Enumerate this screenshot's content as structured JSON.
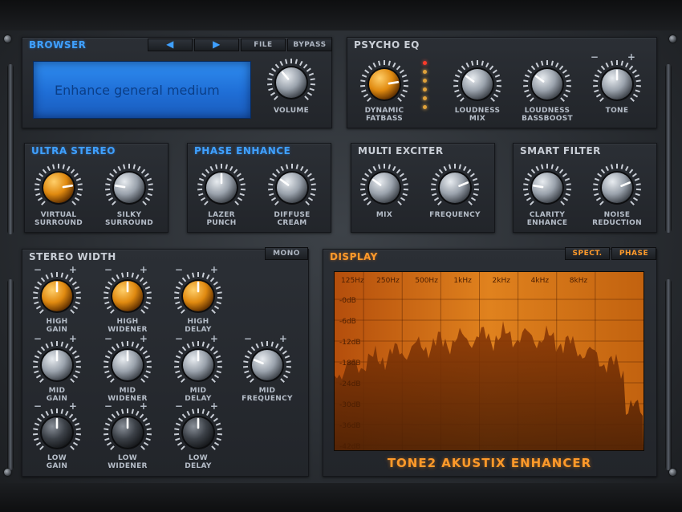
{
  "browser": {
    "title": "BROWSER",
    "prev_icon": "arrow-left-icon",
    "next_icon": "arrow-right-icon",
    "file_label": "FILE",
    "bypass_label": "BYPASS",
    "preset_name": "Enhance general medium",
    "volume_label": "VOLUME",
    "volume_level": 0.35
  },
  "psycho_eq": {
    "title": "PSYCHO EQ",
    "knobs": [
      {
        "label_top": "DYNAMIC",
        "label_bottom": "FATBASS",
        "value": 0.8,
        "color": "orange"
      },
      {
        "label_top": "LOUDNESS",
        "label_bottom": "MIX",
        "value": 0.3,
        "color": "grey"
      },
      {
        "label_top": "LOUDNESS",
        "label_bottom": "BASSBOOST",
        "value": 0.3,
        "color": "grey"
      },
      {
        "label_top": "TONE",
        "label_bottom": "",
        "value": 0.5,
        "color": "grey"
      }
    ],
    "tone_minus": "−",
    "tone_plus": "+"
  },
  "ultra_stereo": {
    "title": "ULTRA STEREO",
    "knobs": [
      {
        "label_top": "VIRTUAL",
        "label_bottom": "SURROUND",
        "value": 0.8,
        "color": "orange"
      },
      {
        "label_top": "SILKY",
        "label_bottom": "SURROUND",
        "value": 0.2,
        "color": "grey"
      }
    ]
  },
  "phase_enhance": {
    "title": "PHASE ENHANCE",
    "knobs": [
      {
        "label_top": "LAZER",
        "label_bottom": "PUNCH",
        "value": 0.5,
        "color": "grey"
      },
      {
        "label_top": "DIFFUSE",
        "label_bottom": "CREAM",
        "value": 0.3,
        "color": "grey"
      }
    ]
  },
  "multi_exciter": {
    "title": "MULTI EXCITER",
    "knobs": [
      {
        "label_top": "MIX",
        "label_bottom": "",
        "value": 0.3,
        "color": "grey"
      },
      {
        "label_top": "FREQUENCY",
        "label_bottom": "",
        "value": 0.75,
        "color": "grey"
      }
    ]
  },
  "smart_filter": {
    "title": "SMART FILTER",
    "knobs": [
      {
        "label_top": "CLARITY",
        "label_bottom": "ENHANCE",
        "value": 0.2,
        "color": "grey"
      },
      {
        "label_top": "NOISE",
        "label_bottom": "REDUCTION",
        "value": 0.75,
        "color": "grey"
      }
    ]
  },
  "stereo_width": {
    "title": "STEREO WIDTH",
    "mono_label": "MONO",
    "minus": "−",
    "plus": "+",
    "knobs": [
      {
        "label_top": "HIGH",
        "label_bottom": "GAIN",
        "value": 0.5,
        "color": "orange"
      },
      {
        "label_top": "HIGH",
        "label_bottom": "WIDENER",
        "value": 0.5,
        "color": "orange"
      },
      {
        "label_top": "HIGH",
        "label_bottom": "DELAY",
        "value": 0.5,
        "color": "orange"
      },
      {
        "label_top": "MID",
        "label_bottom": "GAIN",
        "value": 0.5,
        "color": "grey"
      },
      {
        "label_top": "MID",
        "label_bottom": "WIDENER",
        "value": 0.5,
        "color": "grey"
      },
      {
        "label_top": "MID",
        "label_bottom": "DELAY",
        "value": 0.5,
        "color": "grey"
      },
      {
        "label_top": "LOW",
        "label_bottom": "GAIN",
        "value": 0.5,
        "color": "dark"
      },
      {
        "label_top": "LOW",
        "label_bottom": "WIDENER",
        "value": 0.5,
        "color": "dark"
      },
      {
        "label_top": "LOW",
        "label_bottom": "DELAY",
        "value": 0.5,
        "color": "dark"
      },
      {
        "label_top": "MID",
        "label_bottom": "FREQUENCY",
        "value": 0.25,
        "color": "grey"
      }
    ]
  },
  "display": {
    "title": "DISPLAY",
    "spect_label": "SPECT.",
    "phase_label": "PHASE",
    "freq_labels": [
      "125Hz",
      "250Hz",
      "500Hz",
      "1kHz",
      "2kHz",
      "4kHz",
      "8kHz"
    ],
    "db_labels": [
      "-0dB",
      "-6dB",
      "-12dB",
      "-18dB",
      "-24dB",
      "-30dB",
      "-36dB",
      "-42dB"
    ]
  },
  "brand": "TONE2 AKUSTIX ENHANCER",
  "colors": {
    "accent_blue": "#3fa0ff",
    "accent_orange": "#ff9a2a",
    "lcd_blue": "#1f6ed6"
  }
}
